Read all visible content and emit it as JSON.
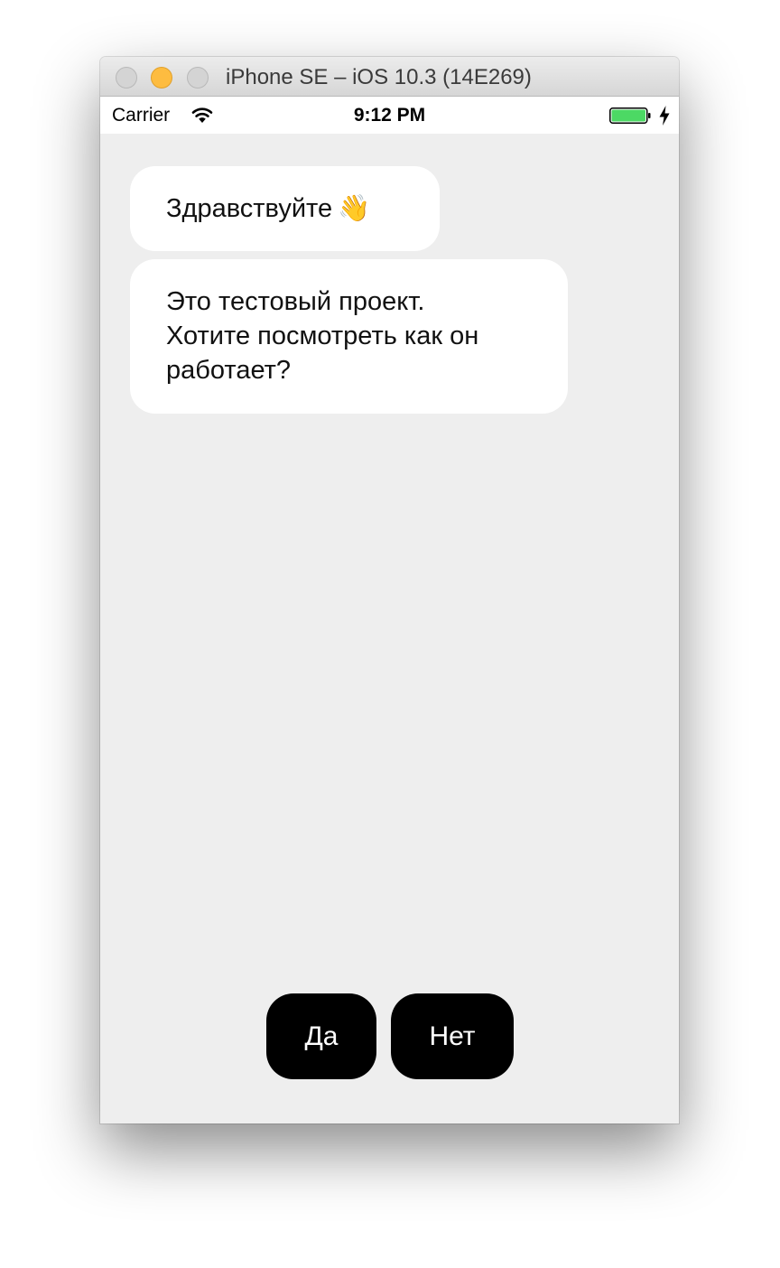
{
  "window": {
    "title": "iPhone SE – iOS 10.3 (14E269)"
  },
  "status_bar": {
    "carrier": "Carrier",
    "time": "9:12 PM",
    "battery_color": "#4cd964"
  },
  "messages": [
    {
      "text": "Здравствуйте",
      "emoji": "👋"
    },
    {
      "lines": [
        "Это тестовый проект.",
        "Хотите посмотреть как он",
        "работает?"
      ]
    }
  ],
  "replies": {
    "yes_label": "Да",
    "no_label": "Нет"
  },
  "colors": {
    "chat_background": "#eeeeee",
    "bubble": "#ffffff",
    "reply_button": "#000000"
  }
}
